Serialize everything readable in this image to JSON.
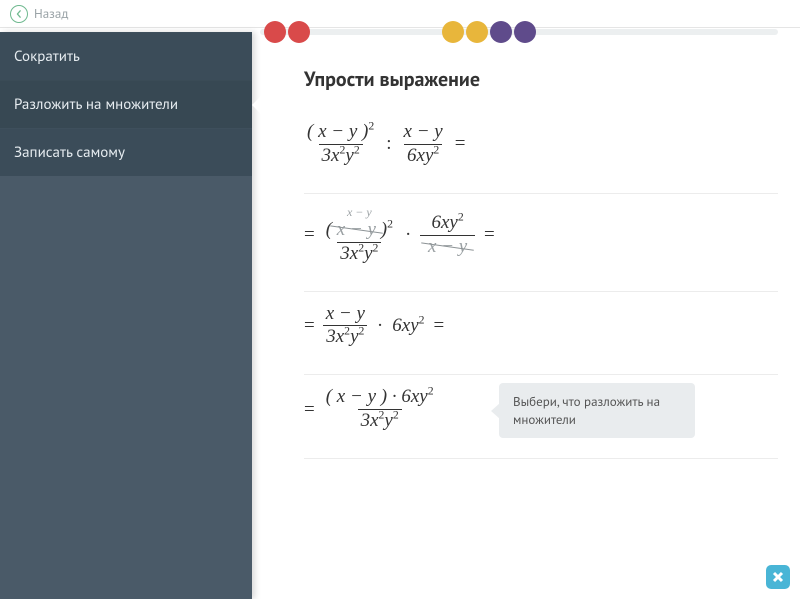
{
  "topbar": {
    "back_label": "Назад"
  },
  "progress_dots": [
    {
      "color": "red"
    },
    {
      "color": "red"
    },
    {
      "gap": true
    },
    {
      "color": "yellow"
    },
    {
      "color": "yellow"
    },
    {
      "color": "purple"
    },
    {
      "color": "purple"
    }
  ],
  "sidebar": {
    "items": [
      {
        "label": "Сократить",
        "selected": false
      },
      {
        "label": "Разложить на множители",
        "selected": true
      },
      {
        "label": "Записать самому",
        "selected": false
      }
    ]
  },
  "content": {
    "title": "Упрости выражение",
    "tooltip": "Выбери, что разложить на множители",
    "math_source": {
      "original": "(x−y)^2 / (3x^2 y^2) : (x−y) / (6xy^2) =",
      "steps": [
        "= (x−y)^2 / (3x^2 y^2) · 6xy^2 / (x−y) =   [cancel one (x−y) and flip divisor]",
        "= (x−y) / (3x^2 y^2) · 6xy^2 =",
        "= ( (x−y) · 6xy^2 ) / (3x^2 y^2)"
      ],
      "cancel_annotation": "x − y"
    }
  },
  "footer": {
    "close_icon": "close-icon"
  }
}
